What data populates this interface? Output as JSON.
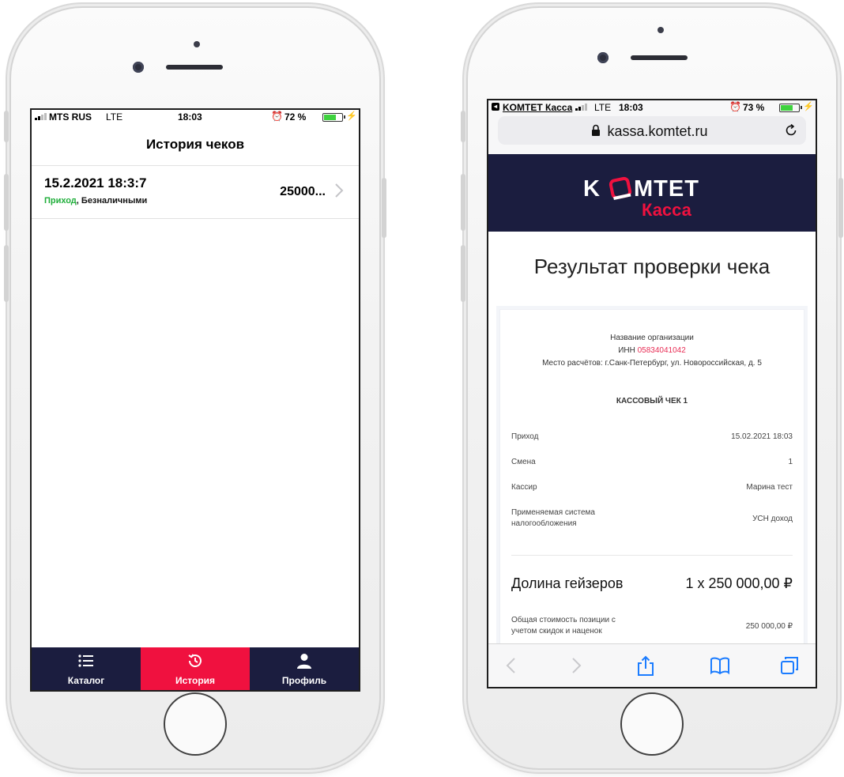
{
  "colors": {
    "navy": "#1b1d3f",
    "accent_red": "#f0113f",
    "green": "#1fae3a",
    "link_red": "#e82d55",
    "battery_green": "#3ed23e"
  },
  "left": {
    "status": {
      "carrier": "MTS RUS",
      "network": "LTE",
      "time": "18:03",
      "battery": "72 %"
    },
    "nav_title": "История чеков",
    "receipts": [
      {
        "date": "15.2.2021 18:3:7",
        "type": "Приход",
        "payment": ", Безналичными",
        "amount": "25000..."
      }
    ],
    "tabs": [
      {
        "label": "Каталог",
        "icon": "list-icon",
        "active": false
      },
      {
        "label": "История",
        "icon": "history-icon",
        "active": true
      },
      {
        "label": "Профиль",
        "icon": "person-icon",
        "active": false
      }
    ]
  },
  "right": {
    "status": {
      "back_app": "KOMTET Касса",
      "network": "LTE",
      "time": "18:03",
      "battery": "73 %"
    },
    "url": "kassa.komtet.ru",
    "brand": {
      "line1_left": "K",
      "line1_right": "MTET",
      "line2": "Касса"
    },
    "page_title": "Результат проверки чека",
    "receipt": {
      "org_name": "Название организации",
      "inn_label": "ИНН ",
      "inn_value": "05834041042",
      "place": "Место расчётов: г.Санк-Петербург, ул. Новороссийская, д. 5",
      "receipt_title": "КАССОВЫЙ ЧЕК 1",
      "rows": [
        {
          "key": "Приход",
          "value": "15.02.2021 18:03"
        },
        {
          "key": "Смена",
          "value": "1"
        },
        {
          "key": "Кассир",
          "value": "Марина тест"
        },
        {
          "key": "Применяемая система налогообложения",
          "value": "УСН доход"
        }
      ],
      "item_name": "Долина гейзеров",
      "item_qty": "1 x 250 000,00 ₽",
      "total_label": "Общая стоимость позиции с учетом скидок и наценок",
      "total_value": "250 000,00 ₽"
    }
  }
}
